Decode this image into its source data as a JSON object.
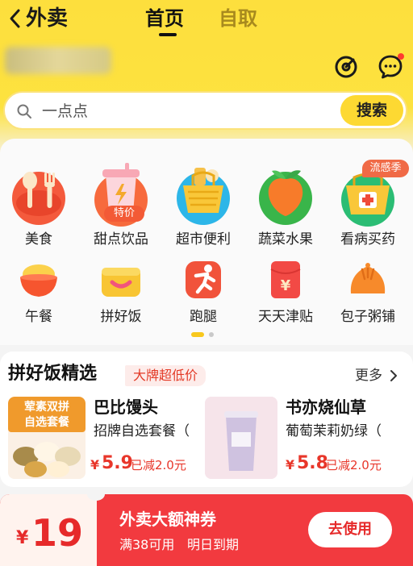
{
  "nav": {
    "title": "外卖",
    "tabs": [
      {
        "label": "首页",
        "active": true
      },
      {
        "label": "自取",
        "active": false
      }
    ]
  },
  "header": {
    "icons": [
      "scan-icon",
      "chat-icon"
    ]
  },
  "search": {
    "placeholder": "一点点",
    "button": "搜索"
  },
  "categories_row1": [
    {
      "label": "美食",
      "icon": "food-icon"
    },
    {
      "label": "甜点饮品",
      "icon": "drink-icon",
      "badge": "特价"
    },
    {
      "label": "超市便利",
      "icon": "basket-icon"
    },
    {
      "label": "蔬菜水果",
      "icon": "fruit-icon"
    },
    {
      "label": "看病买药",
      "icon": "medicine-icon",
      "badge": "流感季"
    }
  ],
  "categories_row2": [
    {
      "label": "午餐",
      "icon": "rice-bowl-icon"
    },
    {
      "label": "拼好饭",
      "icon": "box-icon"
    },
    {
      "label": "跑腿",
      "icon": "runner-icon"
    },
    {
      "label": "天天津贴",
      "icon": "red-envelope-icon"
    },
    {
      "label": "包子粥铺",
      "icon": "bun-icon"
    }
  ],
  "pin": {
    "title": "拼好饭精选",
    "tag": "大牌超低价",
    "more": "更多",
    "dishes": [
      {
        "image_text": "荤素双拼\n自选套餐",
        "name": "巴比馒头",
        "desc": "招牌自选套餐（",
        "currency": "¥",
        "price": "5.9",
        "saved": "已减2.0元"
      },
      {
        "name": "书亦烧仙草",
        "desc": "葡萄茉莉奶绿（",
        "currency": "¥",
        "price": "5.8",
        "saved": "已减2.0元"
      }
    ]
  },
  "coupon": {
    "currency": "¥",
    "amount": "19",
    "title": "外卖大额神券",
    "condition": "满38可用",
    "expiry": "明日到期",
    "button": "去使用"
  },
  "colors": {
    "brand_yellow": "#fddf3d",
    "price_red": "#e8362a",
    "coupon_red": "#f23a3f"
  }
}
